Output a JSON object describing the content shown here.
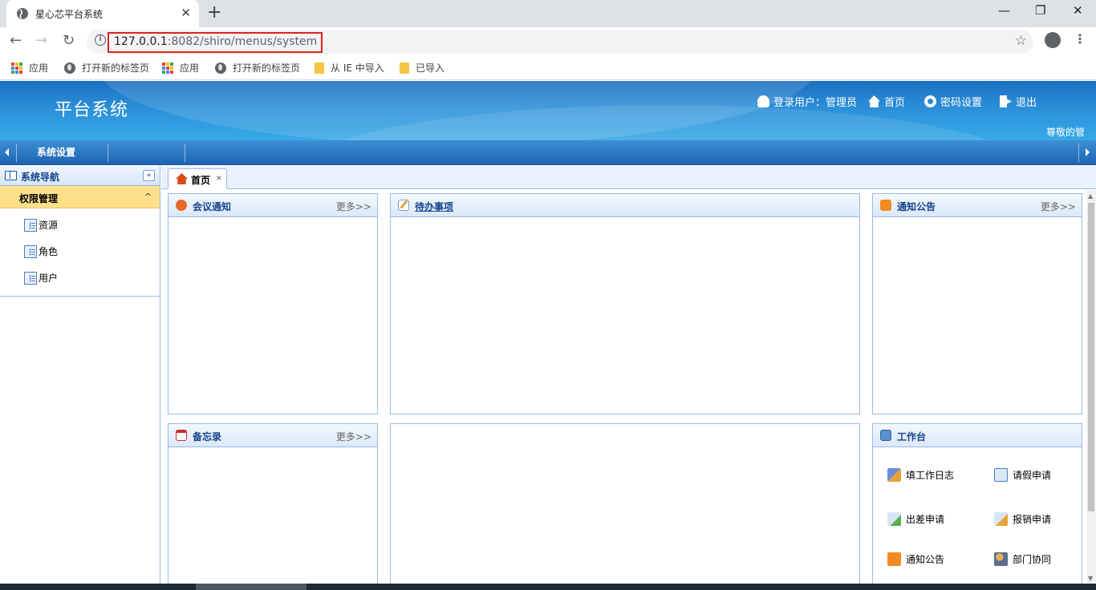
{
  "browser": {
    "tab_title": "星心芯平台系统",
    "tab_close": "✕",
    "new_tab": "+",
    "window_controls": [
      "—",
      "❐",
      "✕"
    ],
    "nav": {
      "back": "←",
      "forward": "→",
      "reload": "↻"
    },
    "url_host": "127.0.0.1",
    "url_path": ":8082/shiro/menus/system",
    "star": "☆",
    "kebab": "⋮",
    "highlight_color": "#e0211a",
    "bookmarks": [
      {
        "icon": "apps-grid-icon",
        "label": "应用"
      },
      {
        "icon": "globe-icon",
        "label": "打开新的标签页"
      },
      {
        "icon": "apps-grid-icon",
        "label": "应用"
      },
      {
        "icon": "globe-icon",
        "label": "打开新的标签页"
      },
      {
        "icon": "folder-icon",
        "label": "从 IE 中导入"
      },
      {
        "icon": "folder-icon",
        "label": "已导入"
      }
    ]
  },
  "header": {
    "title": "平台系统",
    "login_user": "登录用户：管理员",
    "home": "首页",
    "password": "密码设置",
    "logout": "退出",
    "welcome": "尊敬的管"
  },
  "menubar": {
    "items": [
      "系统设置"
    ]
  },
  "sidebar": {
    "title": "系统导航",
    "collapse": "«",
    "group": "权限管理",
    "group_caret": "^",
    "items": [
      "资源",
      "角色",
      "用户"
    ]
  },
  "tabs": [
    {
      "label": "首页",
      "close": "×"
    }
  ],
  "panels": {
    "meeting": {
      "title": "会议通知",
      "more": "更多>>"
    },
    "todo": {
      "title": "待办事项"
    },
    "notice": {
      "title": "通知公告",
      "more": "更多>>"
    },
    "memo": {
      "title": "备忘录",
      "more": "更多>>"
    },
    "workbench": {
      "title": "工作台",
      "items": [
        "填工作日志",
        "请假申请",
        "出差申请",
        "报销申请",
        "通知公告",
        "部门协同"
      ]
    }
  },
  "colors": {
    "header_blue": "#2b8fd8",
    "accordion_yellow": "#ffe08a",
    "panel_title": "#15428b"
  }
}
